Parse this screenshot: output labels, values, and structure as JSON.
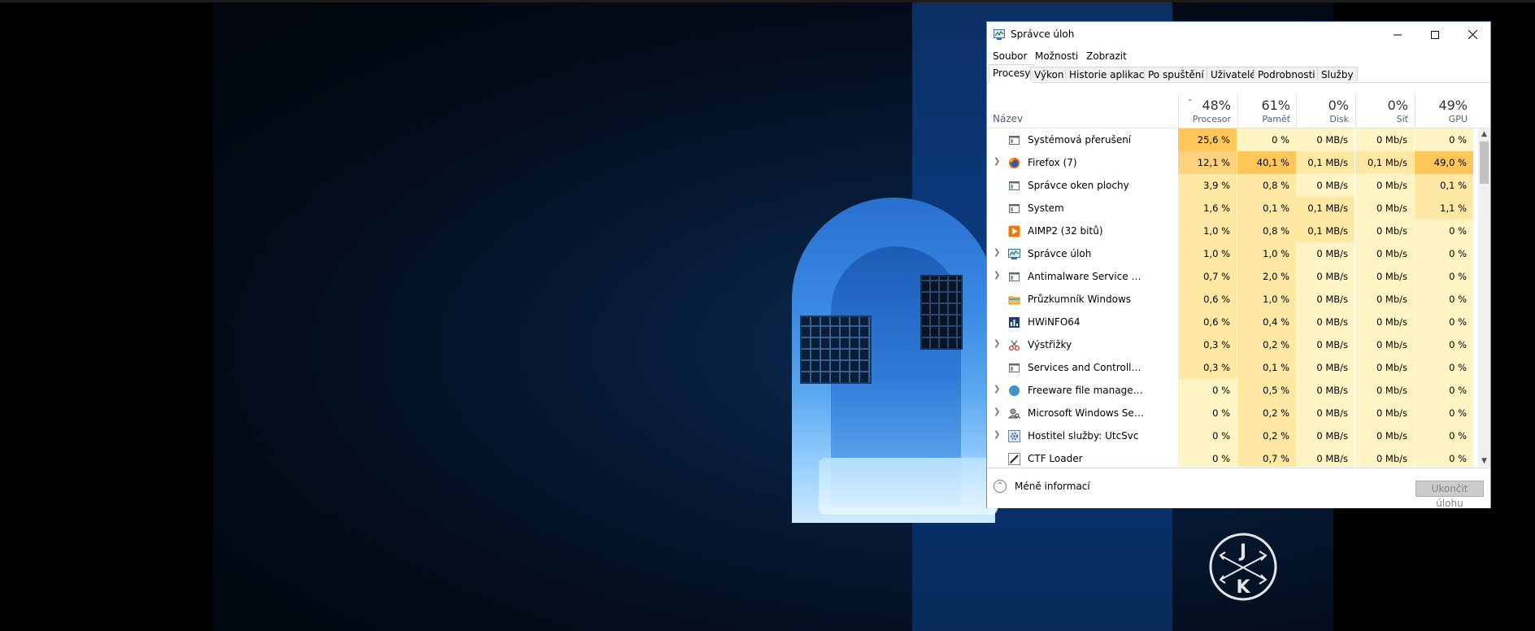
{
  "window": {
    "title": "Správce úloh",
    "icon": "task-manager-icon"
  },
  "menu": [
    "Soubor",
    "Možnosti",
    "Zobrazit"
  ],
  "tabs": [
    "Procesy",
    "Výkon",
    "Historie aplikací",
    "Po spuštění",
    "Uživatelé",
    "Podrobnosti",
    "Služby"
  ],
  "active_tab": "Procesy",
  "columns": {
    "name_label": "Název",
    "cpu": {
      "pct": "48%",
      "label": "Procesor"
    },
    "memory": {
      "pct": "61%",
      "label": "Paměť"
    },
    "disk": {
      "pct": "0%",
      "label": "Disk"
    },
    "network": {
      "pct": "0%",
      "label": "Síť"
    },
    "gpu": {
      "pct": "49%",
      "label": "GPU"
    }
  },
  "processes": [
    {
      "name": "Systémová přerušení",
      "expandable": false,
      "icon": "app-window-icon",
      "cpu": "25,6 %",
      "mem": "0 %",
      "disk": "0 MB/s",
      "net": "0 Mb/s",
      "gpu": "0 %"
    },
    {
      "name": "Firefox (7)",
      "expandable": true,
      "icon": "firefox-icon",
      "cpu": "12,1 %",
      "mem": "40,1 %",
      "disk": "0,1 MB/s",
      "net": "0,1 Mb/s",
      "gpu": "49,0 %"
    },
    {
      "name": "Správce oken plochy",
      "expandable": false,
      "icon": "app-window-icon",
      "cpu": "3,9 %",
      "mem": "0,8 %",
      "disk": "0 MB/s",
      "net": "0 Mb/s",
      "gpu": "0,1 %"
    },
    {
      "name": "System",
      "expandable": false,
      "icon": "app-window-icon",
      "cpu": "1,6 %",
      "mem": "0,1 %",
      "disk": "0,1 MB/s",
      "net": "0 Mb/s",
      "gpu": "1,1 %"
    },
    {
      "name": "AIMP2 (32 bitů)",
      "expandable": false,
      "icon": "aimp-icon",
      "cpu": "1,0 %",
      "mem": "0,8 %",
      "disk": "0,1 MB/s",
      "net": "0 Mb/s",
      "gpu": "0 %"
    },
    {
      "name": "Správce úloh",
      "expandable": true,
      "icon": "task-manager-icon",
      "cpu": "1,0 %",
      "mem": "1,0 %",
      "disk": "0 MB/s",
      "net": "0 Mb/s",
      "gpu": "0 %"
    },
    {
      "name": "Antimalware Service Executable",
      "expandable": true,
      "icon": "app-window-icon",
      "cpu": "0,7 %",
      "mem": "2,0 %",
      "disk": "0 MB/s",
      "net": "0 Mb/s",
      "gpu": "0 %"
    },
    {
      "name": "Průzkumník Windows",
      "expandable": false,
      "icon": "folder-icon",
      "cpu": "0,6 %",
      "mem": "1,0 %",
      "disk": "0 MB/s",
      "net": "0 Mb/s",
      "gpu": "0 %"
    },
    {
      "name": "HWiNFO64",
      "expandable": false,
      "icon": "hwinfo-icon",
      "cpu": "0,6 %",
      "mem": "0,4 %",
      "disk": "0 MB/s",
      "net": "0 Mb/s",
      "gpu": "0 %"
    },
    {
      "name": "Výstřižky",
      "expandable": true,
      "icon": "snipping-tool-icon",
      "cpu": "0,3 %",
      "mem": "0,2 %",
      "disk": "0 MB/s",
      "net": "0 Mb/s",
      "gpu": "0 %"
    },
    {
      "name": "Services and Controller app",
      "expandable": false,
      "icon": "app-window-icon",
      "cpu": "0,3 %",
      "mem": "0,1 %",
      "disk": "0 MB/s",
      "net": "0 Mb/s",
      "gpu": "0 %"
    },
    {
      "name": "Freeware file manager for wind...",
      "expandable": true,
      "icon": "globe-icon",
      "cpu": "0 %",
      "mem": "0,5 %",
      "disk": "0 MB/s",
      "net": "0 Mb/s",
      "gpu": "0 %"
    },
    {
      "name": "Microsoft Windows Search In...",
      "expandable": true,
      "icon": "search-person-icon",
      "cpu": "0 %",
      "mem": "0,2 %",
      "disk": "0 MB/s",
      "net": "0 Mb/s",
      "gpu": "0 %"
    },
    {
      "name": "Hostitel služby: UtcSvc",
      "expandable": true,
      "icon": "gear-icon",
      "cpu": "0 %",
      "mem": "0,2 %",
      "disk": "0 MB/s",
      "net": "0 Mb/s",
      "gpu": "0 %"
    },
    {
      "name": "CTF Loader",
      "expandable": false,
      "icon": "pen-icon",
      "cpu": "0 %",
      "mem": "0,7 %",
      "disk": "0 MB/s",
      "net": "0 Mb/s",
      "gpu": "0 %"
    }
  ],
  "footer": {
    "fewer_details": "Méně informací",
    "end_task": "Ukončit úlohu"
  },
  "logo": {
    "letters": [
      "J",
      "K"
    ]
  },
  "colors": {
    "heat_low": "#fff4c4",
    "heat_mid": "#ffe8a3",
    "heat_high": "#ffd280",
    "heat_max": "#ffc75a",
    "accent_border": "#6f8fb5"
  }
}
